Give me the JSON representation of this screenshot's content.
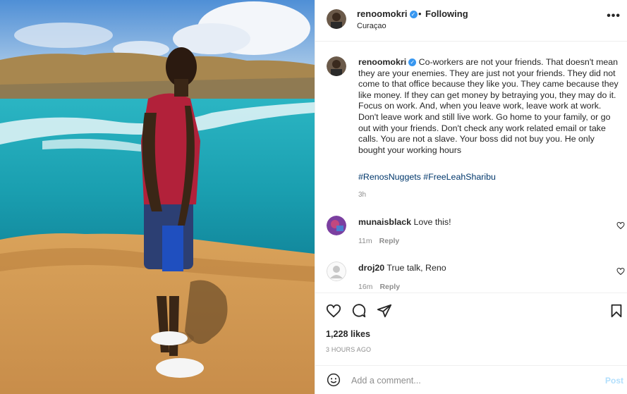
{
  "post": {
    "username": "renoomokri",
    "follow_status": "Following",
    "location": "Curaçao",
    "more_icon": "more-options-icon"
  },
  "caption": {
    "username": "renoomokri",
    "text": "Co-workers are not your friends. That doesn't mean they are your enemies. They are just not your friends. They did not come to that office because they like you. They came because they like money. If they can get money by betraying you, they may do it. Focus on work. And, when you leave work, leave work at work. Don't leave work and still live work. Go home to your family, or go out with your friends. Don't check any work related email or take calls. You are not a slave. Your boss did not buy you. He only bought your working hours",
    "hashtags": "#RenosNuggets #FreeLeahSharibu",
    "time": "3h"
  },
  "comments": [
    {
      "username": "munaisblack",
      "text": "Love this!",
      "time": "11m",
      "reply": "Reply"
    },
    {
      "username": "droj20",
      "text": "True talk, Reno",
      "time": "16m",
      "reply": "Reply"
    }
  ],
  "actions": {
    "likes": "1,228 likes",
    "posted": "3 HOURS AGO",
    "icons": [
      "heart-icon",
      "comment-icon",
      "share-icon",
      "bookmark-icon"
    ]
  },
  "add_comment": {
    "placeholder": "Add a comment...",
    "post_label": "Post"
  },
  "colors": {
    "verified": "#3897f0",
    "hashtag": "#00376b",
    "post_disabled": "#b2dffc"
  }
}
